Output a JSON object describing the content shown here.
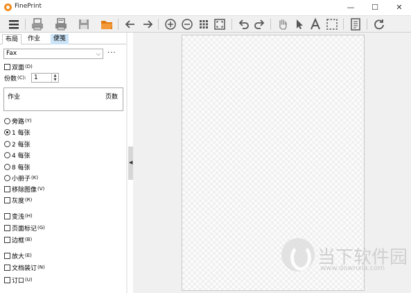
{
  "app": {
    "title": "FinePrint"
  },
  "window_controls": {
    "minimize": "—",
    "maximize": "☐",
    "close": "✕"
  },
  "toolbar": {
    "buttons": [
      "menu-icon",
      "print-icon",
      "print-preview-icon",
      "save-icon",
      "open-folder-icon",
      "back-arrow-icon",
      "forward-arrow-icon",
      "zoom-in-icon",
      "zoom-out-icon",
      "grid-icon",
      "fit-page-icon",
      "undo-icon",
      "redo-icon",
      "hand-icon",
      "pointer-icon",
      "text-icon",
      "select-rect-icon",
      "page-icon",
      "refresh-icon"
    ]
  },
  "tabs": [
    "布局",
    "作业",
    "便笺"
  ],
  "printer_select": {
    "value": "Fax",
    "more": "···"
  },
  "duplex": {
    "label": "双面",
    "key": "(D)"
  },
  "copies": {
    "label": "份数",
    "key": "(C):",
    "value": "1"
  },
  "jobs_list": {
    "col_job": "作业",
    "col_pages": "页数"
  },
  "layout_options": [
    {
      "label": "旁路",
      "key": "(Y)",
      "selected": false
    },
    {
      "label": "1 每张",
      "key": "",
      "selected": true
    },
    {
      "label": "2 每张",
      "key": "",
      "selected": false
    },
    {
      "label": "4 每张",
      "key": "",
      "selected": false
    },
    {
      "label": "8 每张",
      "key": "",
      "selected": false
    },
    {
      "label": "小册子",
      "key": "(K)",
      "selected": false
    }
  ],
  "checks_a": [
    {
      "label": "移除图像",
      "key": "(V)"
    },
    {
      "label": "灰度",
      "key": "(R)"
    }
  ],
  "checks_b": [
    {
      "label": "变浅",
      "key": "(H)"
    },
    {
      "label": "页面标记",
      "key": "(G)"
    },
    {
      "label": "边框",
      "key": "(B)"
    }
  ],
  "checks_c": [
    {
      "label": "放大",
      "key": "(E)"
    },
    {
      "label": "文档装订",
      "key": "(N)"
    },
    {
      "label": "订口",
      "key": "(U)"
    }
  ],
  "watermark": {
    "text": "当下软件园",
    "url": "www.downxia.com"
  },
  "colors": {
    "accent": "#f28c1e",
    "tab_highlight": "#cce4f7",
    "toolbar_bg": "#f0f0f0"
  }
}
